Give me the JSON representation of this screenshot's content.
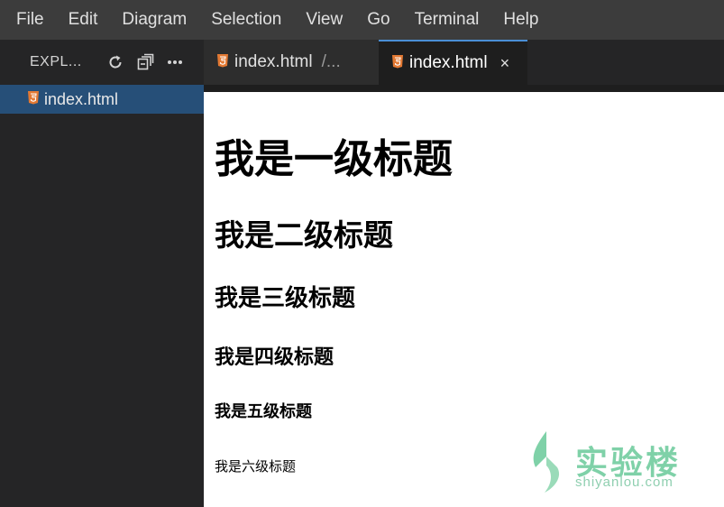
{
  "menubar": {
    "items": [
      {
        "label": "File"
      },
      {
        "label": "Edit"
      },
      {
        "label": "Diagram"
      },
      {
        "label": "Selection"
      },
      {
        "label": "View"
      },
      {
        "label": "Go"
      },
      {
        "label": "Terminal"
      },
      {
        "label": "Help"
      }
    ]
  },
  "sidebar": {
    "title": "EXPL...",
    "actions": [
      "refresh-icon",
      "collapse-all-icon",
      "more-icon"
    ],
    "files": [
      {
        "label": "index.html",
        "icon": "html5-icon",
        "selected": true
      }
    ]
  },
  "tabs": [
    {
      "label": "index.html",
      "path": "/...",
      "active": false,
      "icon": "html5-icon"
    },
    {
      "label": "index.html",
      "close": "×",
      "active": true,
      "icon": "html5-icon"
    }
  ],
  "preview": {
    "h1": "我是一级标题",
    "h2": "我是二级标题",
    "h3": "我是三级标题",
    "h4": "我是四级标题",
    "h5": "我是五级标题",
    "h6": "我是六级标题"
  },
  "watermark": {
    "name": "实验楼",
    "domain": "shiyanlou.com"
  },
  "colors": {
    "accent": "#4a8fd6",
    "selection": "#264f78",
    "html_icon": "#e37933",
    "watermark": "#7fd1a8"
  }
}
